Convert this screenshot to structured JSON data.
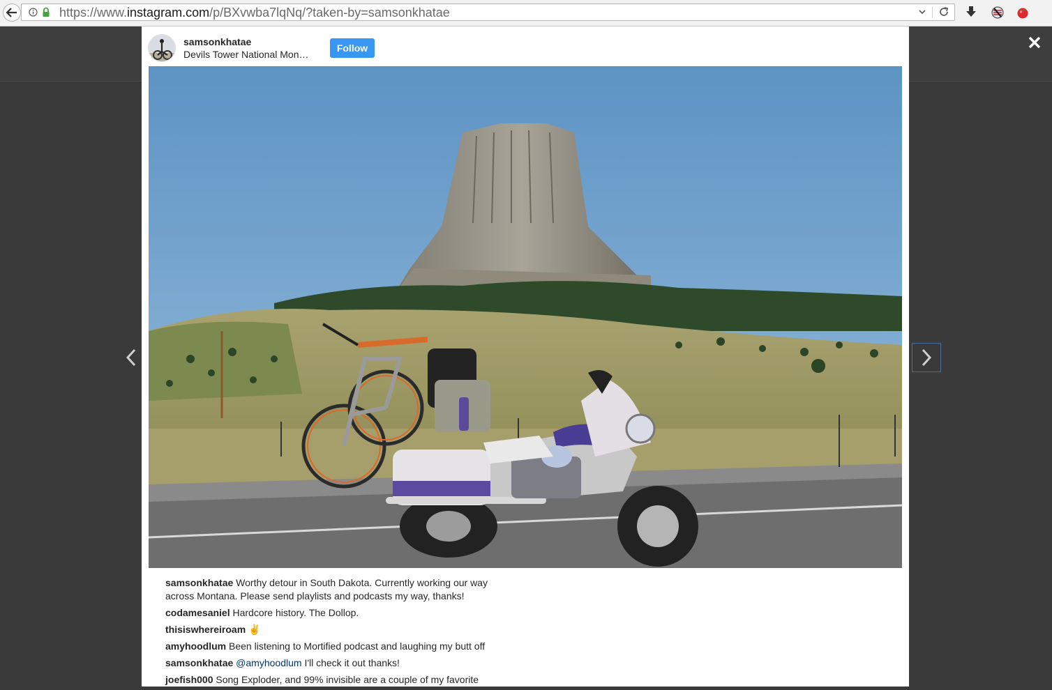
{
  "browser": {
    "url_prefix": "https://www.",
    "url_host": "instagram.com",
    "url_path": "/p/BXvwba7lqNq/?taken-by=samsonkhatae"
  },
  "post": {
    "username": "samsonkhatae",
    "location": "Devils Tower National Mon…",
    "follow_label": "Follow"
  },
  "comments": [
    {
      "author": "samsonkhatae",
      "text": "Worthy detour in South Dakota. Currently working our way across Montana. Please send playlists and podcasts my way, thanks!"
    },
    {
      "author": "codamesaniel",
      "text": "Hardcore history. The Dollop."
    },
    {
      "author": "thisiswhereiroam",
      "text": "✌"
    },
    {
      "author": "amyhoodlum",
      "text": "Been listening to Mortified podcast and laughing my butt off"
    },
    {
      "author": "samsonkhatae",
      "mention": "@amyhoodlum",
      "text": "I'll check it out thanks!"
    },
    {
      "author": "joefish000",
      "text": "Song Exploder, and 99% invisible are a couple of my favorite"
    }
  ],
  "icons": {
    "close": "close-icon",
    "prev": "chevron-left-icon",
    "next": "chevron-right-icon"
  },
  "colors": {
    "follow": "#3897f0",
    "overlay": "#3a3a3a",
    "mention": "#003569"
  }
}
